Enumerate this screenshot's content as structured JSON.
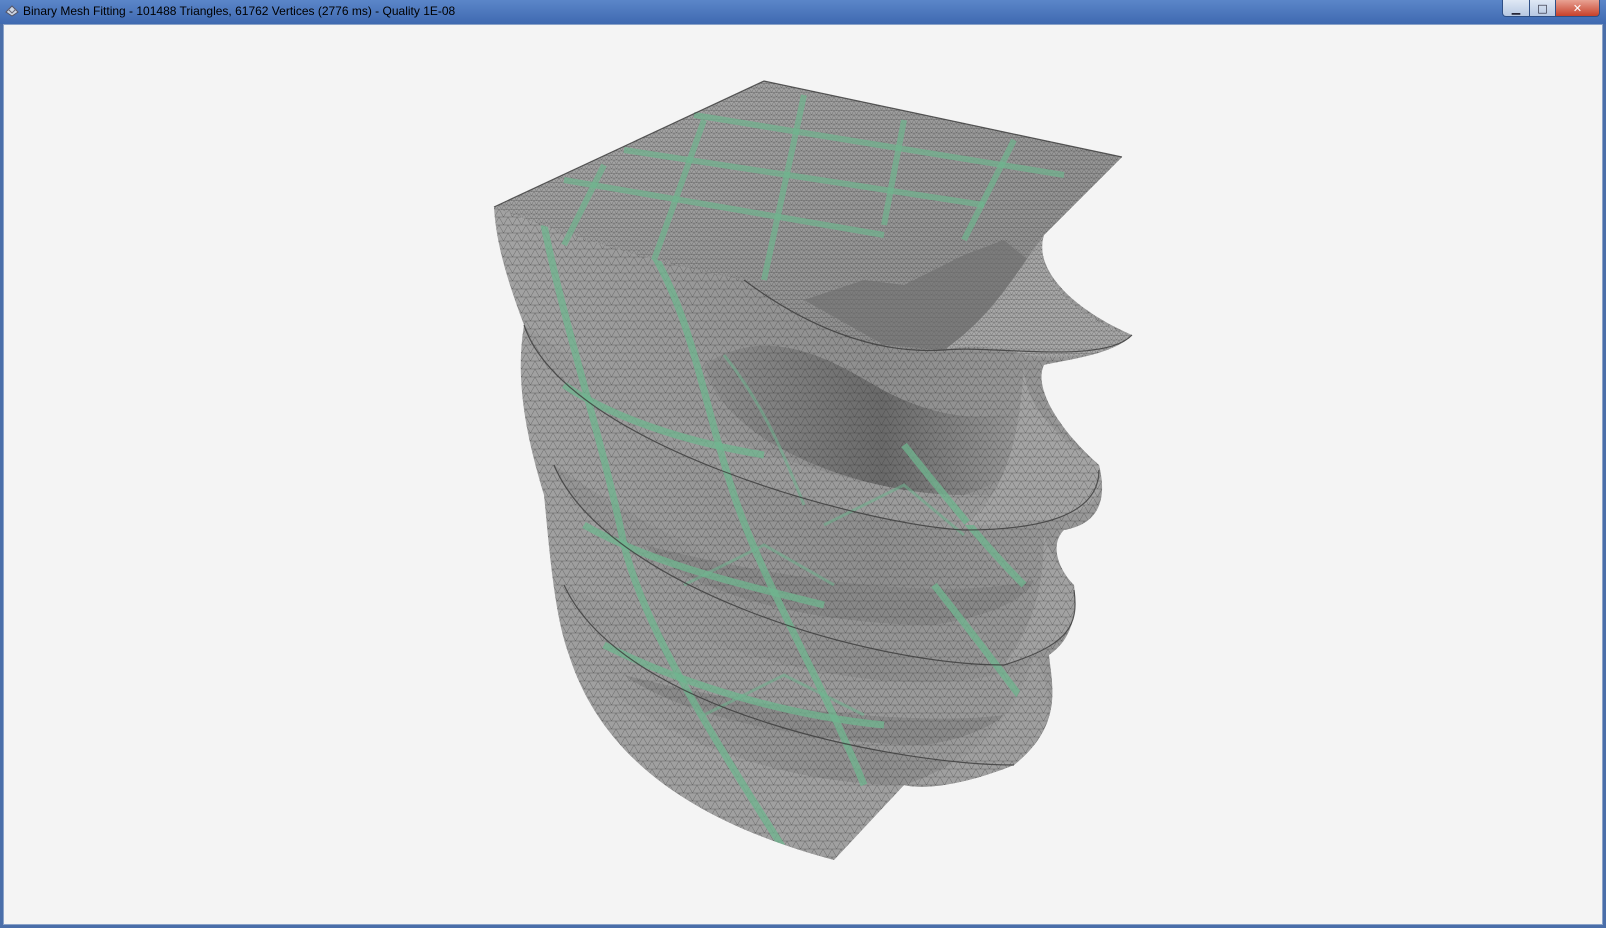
{
  "window": {
    "title": "Binary Mesh Fitting - 101488 Triangles, 61762 Vertices (2776 ms) - Quality 1E-08",
    "minimize_icon": "minimize-icon",
    "maximize_icon": "maximize-icon",
    "close_icon": "close-icon",
    "minimize_glyph": "▁",
    "maximize_glyph": "□",
    "close_glyph": "✕"
  },
  "scene": {
    "background_color": "#f4f4f4",
    "mesh_color": "#8d8d8d",
    "seam_color": "#6fb58f",
    "wire_color": "#2b2b2b"
  }
}
